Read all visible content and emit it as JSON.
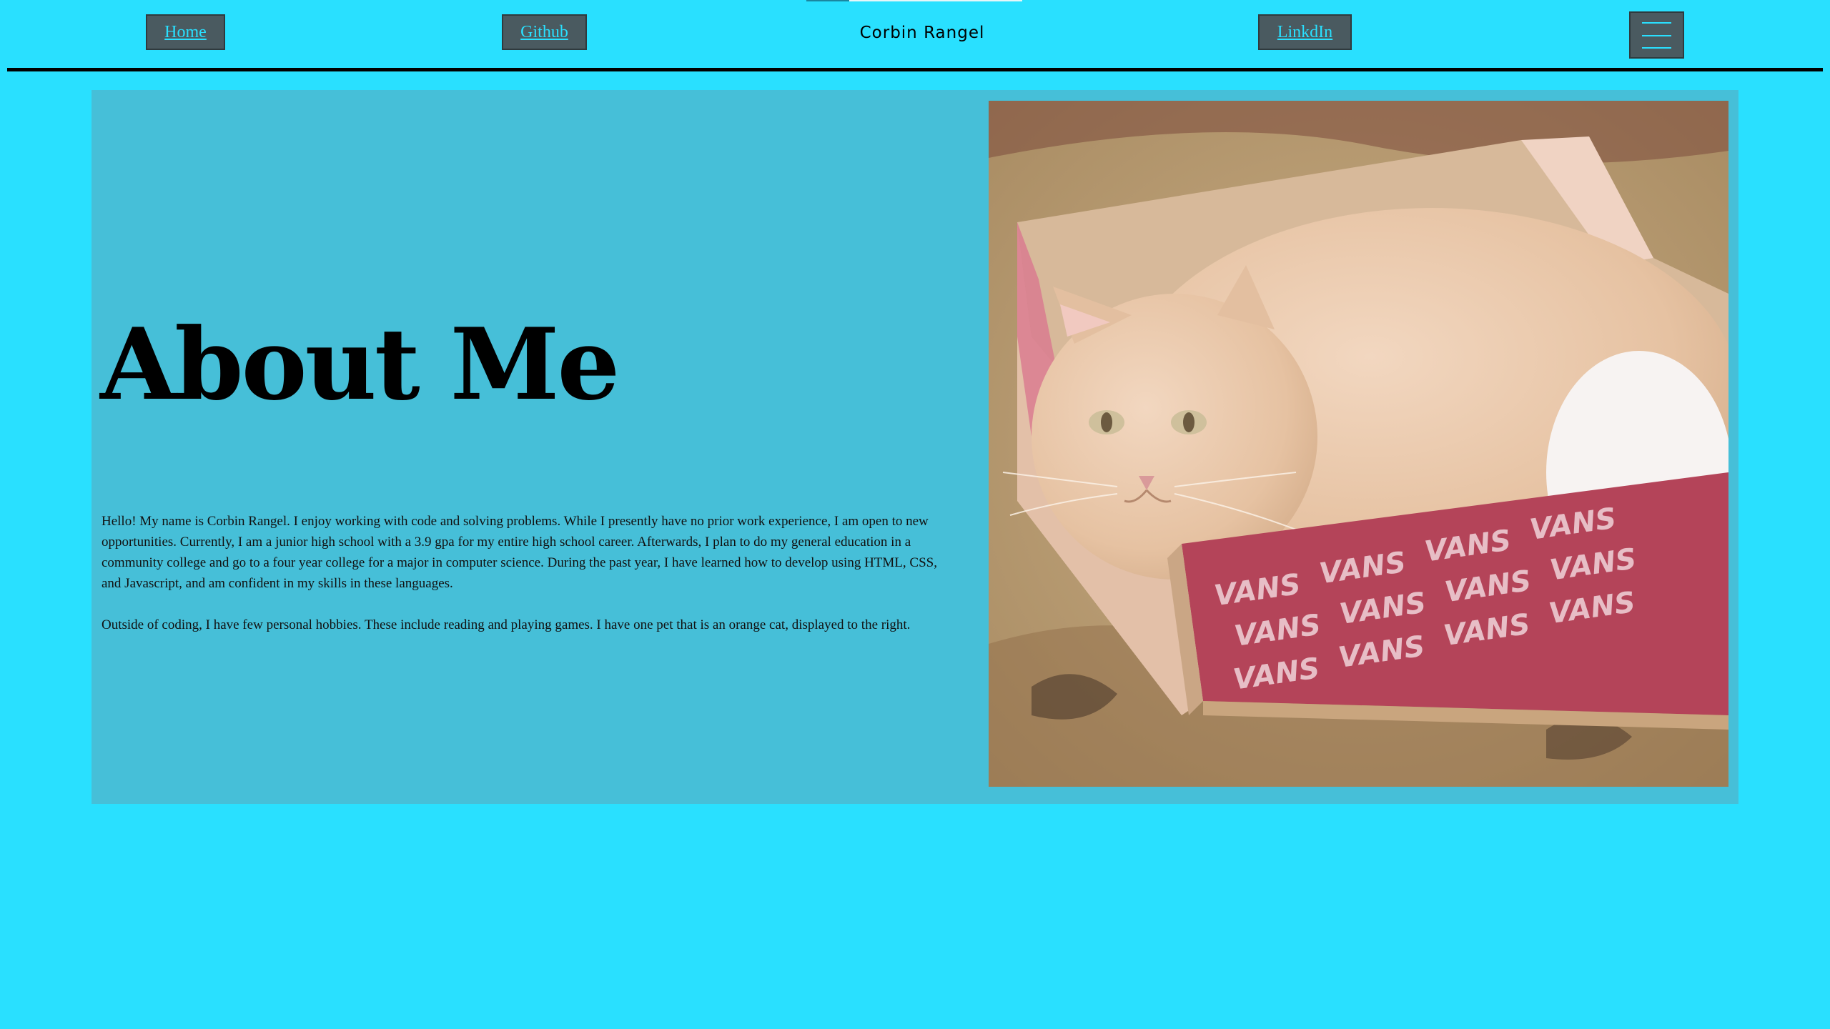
{
  "nav": {
    "home_label": "Home",
    "github_label": "Github",
    "linkdin_label": "LinkdIn",
    "site_title": "Corbin Rangel",
    "menu_icon": "hamburger-menu-icon"
  },
  "about": {
    "heading": "About Me",
    "paragraph_1": "Hello! My name is Corbin Rangel. I enjoy working with code and solving problems. While I presently have no prior work experience, I am open to new opportunities. Currently, I am a junior high school with a 3.9 gpa for my entire high school career. Afterwards, I plan to do my general education in a community college and go to a four year college for a major in computer science. During the past year, I have learned how to develop using HTML, CSS, and Javascript, and am confident in my skills in these languages.",
    "paragraph_2": "Outside of coding, I have few personal hobbies. These include reading and playing games. I have one pet that is an orange cat, displayed to the right.",
    "photo_box_text": "VANS"
  },
  "colors": {
    "page_background": "#29e0ff",
    "panel_background": "#46bfd8",
    "button_background": "#4a5a60",
    "link_color": "#29e0ff"
  }
}
